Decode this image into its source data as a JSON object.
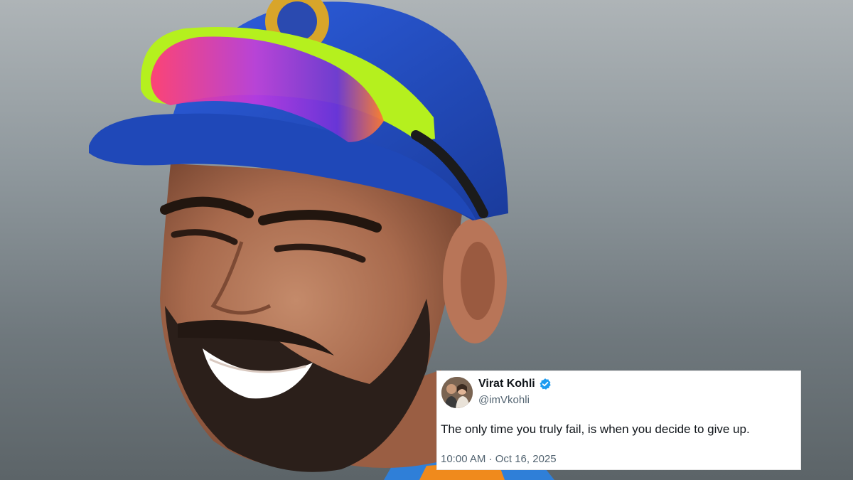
{
  "tweet": {
    "display_name": "Virat Kohli",
    "verified": true,
    "verified_color": "#1d9bf0",
    "handle": "@imVkohli",
    "text": "The only time you truly fail, is when you decide to give up.",
    "timestamp": "10:00 AM · Oct 16, 2025"
  },
  "colors": {
    "card_background": "#ffffff",
    "name_color": "#0f1419",
    "muted_color": "#536471",
    "cap_blue": "#1f4fc9",
    "lens_tint": "#c63fd6",
    "frame_green": "#b5f01e"
  },
  "icons": [
    "verified-badge-icon",
    "avatar"
  ]
}
